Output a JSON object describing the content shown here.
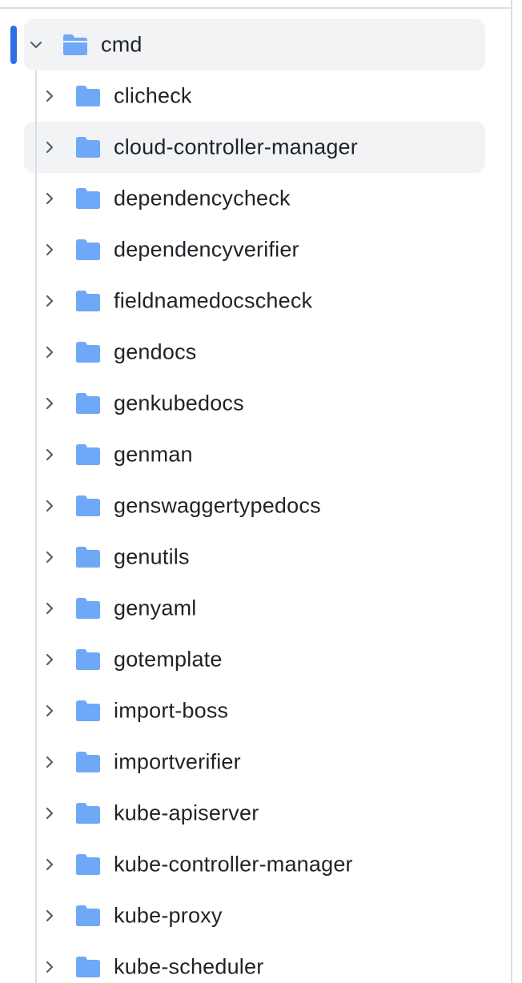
{
  "tree": {
    "root": {
      "label": "cmd",
      "icon": "folder-open-icon",
      "expanded": true
    },
    "children": [
      {
        "label": "clicheck"
      },
      {
        "label": "cloud-controller-manager"
      },
      {
        "label": "dependencycheck"
      },
      {
        "label": "dependencyverifier"
      },
      {
        "label": "fieldnamedocscheck"
      },
      {
        "label": "gendocs"
      },
      {
        "label": "genkubedocs"
      },
      {
        "label": "genman"
      },
      {
        "label": "genswaggertypedocs"
      },
      {
        "label": "genutils"
      },
      {
        "label": "genyaml"
      },
      {
        "label": "gotemplate"
      },
      {
        "label": "import-boss"
      },
      {
        "label": "importverifier"
      },
      {
        "label": "kube-apiserver"
      },
      {
        "label": "kube-controller-manager"
      },
      {
        "label": "kube-proxy"
      },
      {
        "label": "kube-scheduler"
      }
    ]
  },
  "colors": {
    "folder": "#6fa8f6",
    "active_bar": "#2f6fe4",
    "hover_bg": "#f2f3f5",
    "text": "#1f2328",
    "chevron": "#57606a",
    "border": "#d8dee4"
  }
}
